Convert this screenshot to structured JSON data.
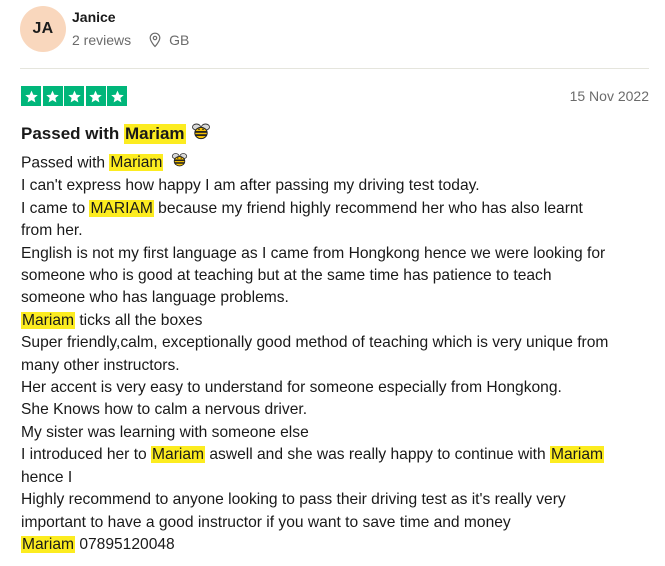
{
  "reviewer": {
    "initials": "JA",
    "name": "Janice",
    "reviews_count": "2 reviews",
    "country": "GB",
    "avatar_color": "#f9d7bd"
  },
  "rating": {
    "stars": 5,
    "max": 5,
    "color": "#00b67a",
    "icon": "star-icon"
  },
  "date": "15 Nov 2022",
  "highlight_color": "#fcec20",
  "title": {
    "prefix": "Passed with ",
    "highlight": "Mariam",
    "emoji_icon": "bee-emoji-icon"
  },
  "body": {
    "l1_prefix": "Passed with ",
    "l1_highlight": "Mariam",
    "l2": "I can't express how happy I am after passing my driving test today.",
    "l3_prefix": "I came to ",
    "l3_highlight": "MARIAM",
    "l3_suffix": " because my friend highly recommend her who has also learnt",
    "l4": "from her.",
    "l5": "English is not my first language as I came from Hongkong hence we were looking for",
    "l6": "someone who is good at teaching but at the same time has patience to teach",
    "l7": "someone who has language problems.",
    "l8_highlight": "Mariam",
    "l8_suffix": " ticks all the boxes",
    "l9": "Super friendly,calm, exceptionally good method of teaching which is very unique from",
    "l10": "many other instructors.",
    "l11": "Her accent is very easy to understand for someone especially from Hongkong.",
    "l12": "She Knows how to calm a nervous driver.",
    "l13": "My sister was learning with someone else",
    "l14_prefix": "I introduced her to ",
    "l14_highlight1": "Mariam",
    "l14_middle": " aswell and she was really happy to continue with ",
    "l14_highlight2": "Mariam",
    "l15": "hence I",
    "l16": "Highly recommend to anyone looking to pass their driving test as it's really very",
    "l17": "important to have a good instructor if you want to save time and money",
    "l18_highlight": "Mariam",
    "l18_suffix": " 07895120048"
  }
}
